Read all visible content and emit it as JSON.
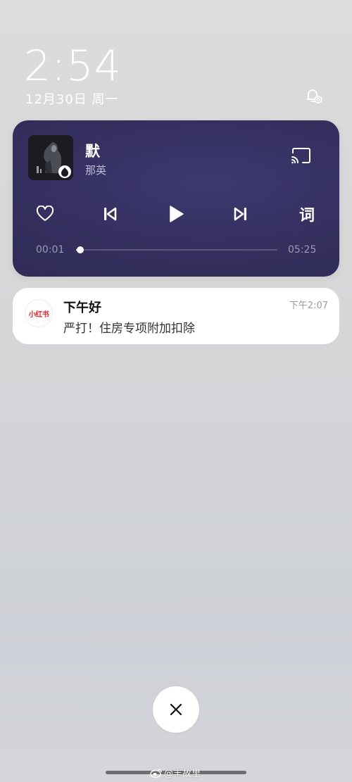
{
  "lockscreen": {
    "time": "2:54",
    "date": "12月30日 周一"
  },
  "music": {
    "title": "默",
    "artist": "那英",
    "lyrics_label": "词",
    "current_time": "00:01",
    "total_time": "05:25",
    "progress": 0.003
  },
  "notification": {
    "app_name": "小红书",
    "title": "下午好",
    "body": "严打！住房专项附加扣除",
    "time": "下午2:07"
  },
  "watermark": {
    "text": "@丰故里"
  },
  "colors": {
    "music_card": "#35305f",
    "app_brand": "#e3262e"
  },
  "icons": [
    "notification-settings-icon",
    "cast-icon",
    "heart-icon",
    "previous-icon",
    "play-icon",
    "next-icon",
    "close-icon",
    "weibo-icon"
  ]
}
